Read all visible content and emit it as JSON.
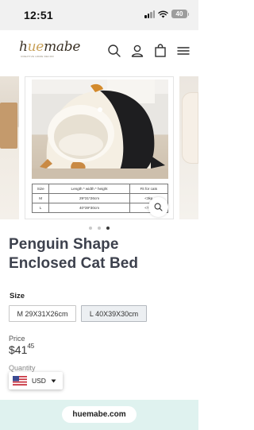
{
  "status_bar": {
    "time": "12:51",
    "battery": "40",
    "icons": [
      "signal-icon",
      "wifi-icon",
      "battery-icon"
    ]
  },
  "header": {
    "logo": {
      "text_dark_1": "h",
      "text_accent": "ue",
      "text_dark_2": "mabe",
      "tagline": "CREATIVE HOME DECOR"
    },
    "icons": [
      "search-icon",
      "account-icon",
      "cart-icon",
      "menu-icon"
    ]
  },
  "gallery": {
    "images_count": 3,
    "active_index": 2,
    "size_table": {
      "headers": [
        "Size",
        "Length * width * height",
        "Fit for cats"
      ],
      "rows": [
        [
          "M",
          "29*31*26cm",
          "<3kg"
        ],
        [
          "L",
          "40*39*30cm",
          "<7kg"
        ]
      ]
    }
  },
  "product": {
    "title": "Penguin Shape Enclosed Cat Bed",
    "size_label": "Size",
    "size_options": [
      {
        "label": "M 29X31X26cm",
        "selected": false
      },
      {
        "label": "L 40X39X30cm",
        "selected": true
      }
    ],
    "price_label": "Price",
    "price_main": "$41",
    "price_cents": "45",
    "quantity_label": "Quantity"
  },
  "currency": {
    "code": "USD",
    "flag": "us-flag-icon"
  },
  "browser": {
    "url": "huemabe.com"
  },
  "colors": {
    "title": "#3d414d",
    "bottom_bar": "#dff2ef",
    "status_bar": "#f1f1f1",
    "accent_gold": "#c9a25b"
  }
}
